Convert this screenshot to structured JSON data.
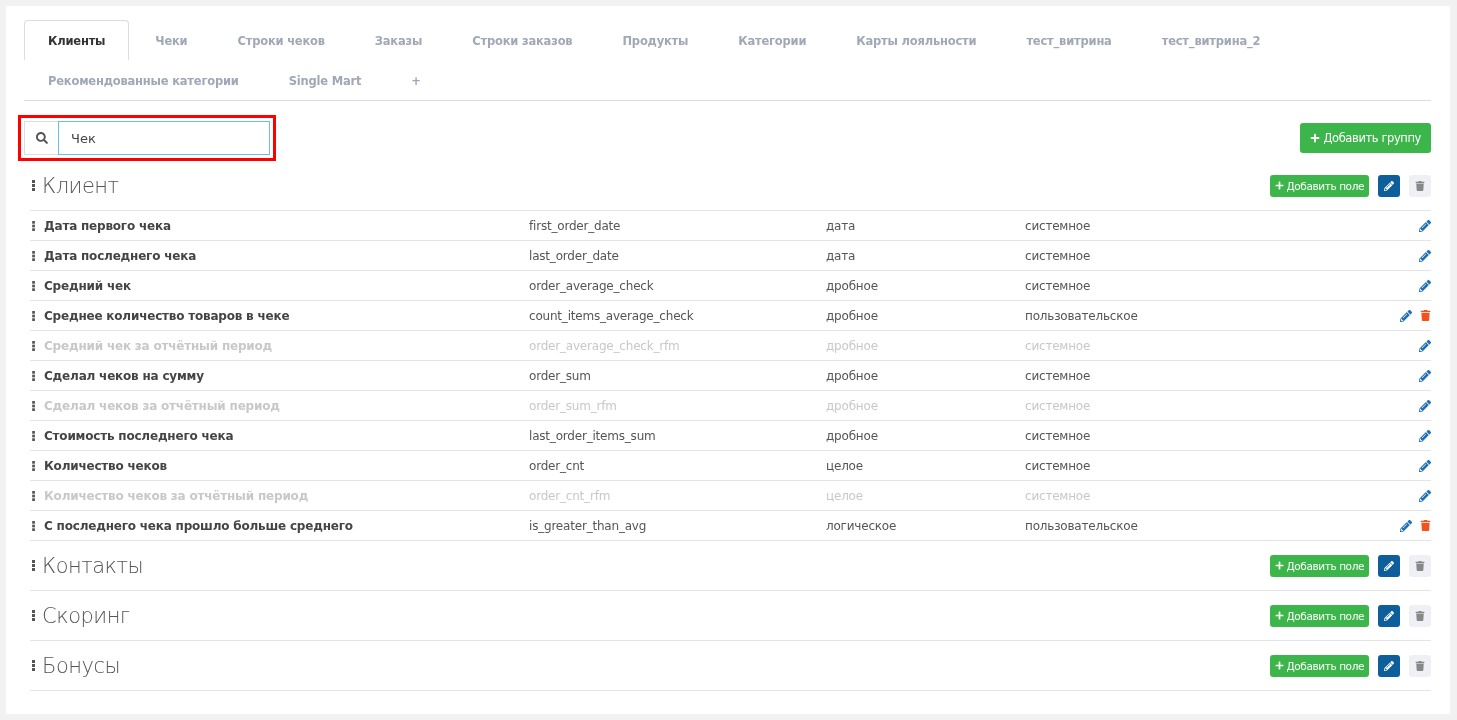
{
  "tabs": [
    {
      "label": "Клиенты",
      "selected": true
    },
    {
      "label": "Чеки",
      "selected": false
    },
    {
      "label": "Строки чеков",
      "selected": false
    },
    {
      "label": "Заказы",
      "selected": false
    },
    {
      "label": "Строки заказов",
      "selected": false
    },
    {
      "label": "Продукты",
      "selected": false
    },
    {
      "label": "Категории",
      "selected": false
    },
    {
      "label": "Карты лояльности",
      "selected": false
    },
    {
      "label": "тест_витрина",
      "selected": false
    },
    {
      "label": "тест_витрина_2",
      "selected": false
    },
    {
      "label": "Рекомендованные категории",
      "selected": false
    },
    {
      "label": "Single Mart",
      "selected": false
    },
    {
      "label": "+",
      "selected": false
    }
  ],
  "search": {
    "value": "Чек",
    "highlighted": true
  },
  "add_group_button": "Добавить группу",
  "groups": [
    {
      "title": "Клиент",
      "add_field_button": "Добавить поле",
      "fields": [
        {
          "name": "Дата первого чека",
          "code": "first_order_date",
          "type": "дата",
          "origin": "системное",
          "disabled": false,
          "deletable": false
        },
        {
          "name": "Дата последнего чека",
          "code": "last_order_date",
          "type": "дата",
          "origin": "системное",
          "disabled": false,
          "deletable": false
        },
        {
          "name": "Средний чек",
          "code": "order_average_check",
          "type": "дробное",
          "origin": "системное",
          "disabled": false,
          "deletable": false
        },
        {
          "name": "Среднее количество товаров в чеке",
          "code": "count_items_average_check",
          "type": "дробное",
          "origin": "пользовательское",
          "disabled": false,
          "deletable": true
        },
        {
          "name": "Средний чек за отчётный период",
          "code": "order_average_check_rfm",
          "type": "дробное",
          "origin": "системное",
          "disabled": true,
          "deletable": false
        },
        {
          "name": "Сделал чеков на сумму",
          "code": "order_sum",
          "type": "дробное",
          "origin": "системное",
          "disabled": false,
          "deletable": false
        },
        {
          "name": "Сделал чеков за отчётный период",
          "code": "order_sum_rfm",
          "type": "дробное",
          "origin": "системное",
          "disabled": true,
          "deletable": false
        },
        {
          "name": "Стоимость последнего чека",
          "code": "last_order_items_sum",
          "type": "дробное",
          "origin": "системное",
          "disabled": false,
          "deletable": false
        },
        {
          "name": "Количество чеков",
          "code": "order_cnt",
          "type": "целое",
          "origin": "системное",
          "disabled": false,
          "deletable": false
        },
        {
          "name": "Количество чеков за отчётный период",
          "code": "order_cnt_rfm",
          "type": "целое",
          "origin": "системное",
          "disabled": true,
          "deletable": false
        },
        {
          "name": "С последнего чека прошло больше среднего",
          "code": "is_greater_than_avg",
          "type": "логическое",
          "origin": "пользовательское",
          "disabled": false,
          "deletable": true
        }
      ]
    },
    {
      "title": "Контакты",
      "add_field_button": "Добавить поле"
    },
    {
      "title": "Скоринг",
      "add_field_button": "Добавить поле"
    },
    {
      "title": "Бонусы",
      "add_field_button": "Добавить поле"
    }
  ]
}
